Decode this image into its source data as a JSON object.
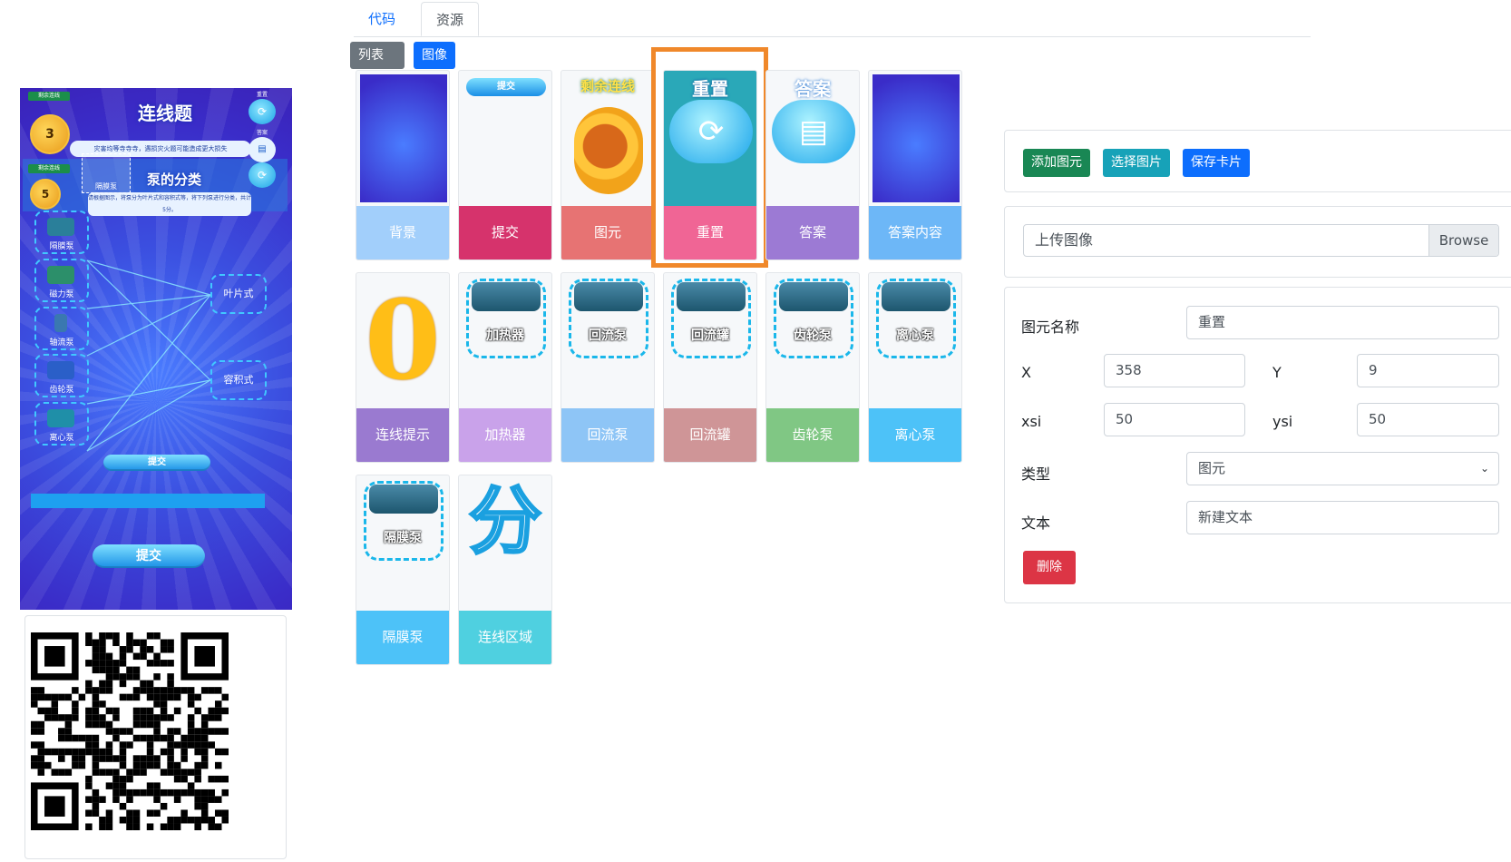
{
  "preview": {
    "title": "连线题",
    "subtitle": "泵的分类",
    "banner": "灾害均等寺寺寺，遇损灾火题可能造成更大损失",
    "banner2": "请根据图示，将泵分为叶片式和容积式等，将下列泵进行分类，共计5分。",
    "medal_top_label": "剩余连线",
    "medal_top_value": "3",
    "medal_mid_label": "剩余连线",
    "medal_mid_value": "5",
    "reset_label": "重置",
    "answer_label": "答案",
    "dragging_label": "隔膜泵",
    "pumps": [
      "隔膜泵",
      "磁力泵",
      "轴流泵",
      "齿轮泵",
      "离心泵"
    ],
    "categories": [
      "叶片式",
      "容积式"
    ],
    "submit_small": "提交",
    "submit_big": "提交"
  },
  "tabs": {
    "code": "代码",
    "resources": "资源"
  },
  "view": {
    "list": "列表 ≡",
    "image": "图像"
  },
  "assets": [
    {
      "label": "背景",
      "color": "#a2cffb",
      "thumb": "bg"
    },
    {
      "label": "提交",
      "color": "#d6336c",
      "thumb": "submit",
      "thumb_text": "提交"
    },
    {
      "label": "图元",
      "color": "#e77373",
      "thumb": "medal",
      "thumb_text": "剩余连线"
    },
    {
      "label": "重置",
      "color": "#f06595",
      "thumb": "reset",
      "thumb_text": "重置",
      "selected": true
    },
    {
      "label": "答案",
      "color": "#9c7ad4",
      "thumb": "answer",
      "thumb_text": "答案"
    },
    {
      "label": "答案内容",
      "color": "#6db7f7",
      "thumb": "bg2"
    },
    {
      "label": "连线提示",
      "color": "#9a7ad0",
      "thumb": "zero",
      "thumb_text": "0"
    },
    {
      "label": "加热器",
      "color": "#c9a2ea",
      "thumb": "pump",
      "thumb_text": "加热器"
    },
    {
      "label": "回流泵",
      "color": "#8ec5f6",
      "thumb": "pump",
      "thumb_text": "回流泵"
    },
    {
      "label": "回流罐",
      "color": "#cf9597",
      "thumb": "pump",
      "thumb_text": "回流罐"
    },
    {
      "label": "齿轮泵",
      "color": "#80c784",
      "thumb": "pump",
      "thumb_text": "齿轮泵"
    },
    {
      "label": "离心泵",
      "color": "#4dc2f8",
      "thumb": "pump",
      "thumb_text": "离心泵"
    },
    {
      "label": "隔膜泵",
      "color": "#4dc2f8",
      "thumb": "pump",
      "thumb_text": "隔膜泵"
    },
    {
      "label": "连线区域",
      "color": "#4fd0e0",
      "thumb": "fen",
      "thumb_text": "分"
    }
  ],
  "toolbar": {
    "add": "添加图元",
    "choose": "选择图片",
    "save": "保存卡片"
  },
  "upload": {
    "placeholder": "上传图像",
    "browse": "Browse"
  },
  "form": {
    "name_label": "图元名称",
    "name_value": "重置",
    "x_label": "X",
    "x_value": "358",
    "y_label": "Y",
    "y_value": "9",
    "xsi_label": "xsi",
    "xsi_value": "50",
    "ysi_label": "ysi",
    "ysi_value": "50",
    "type_label": "类型",
    "type_value": "图元",
    "text_label": "文本",
    "text_value": "新建文本",
    "delete": "删除"
  }
}
